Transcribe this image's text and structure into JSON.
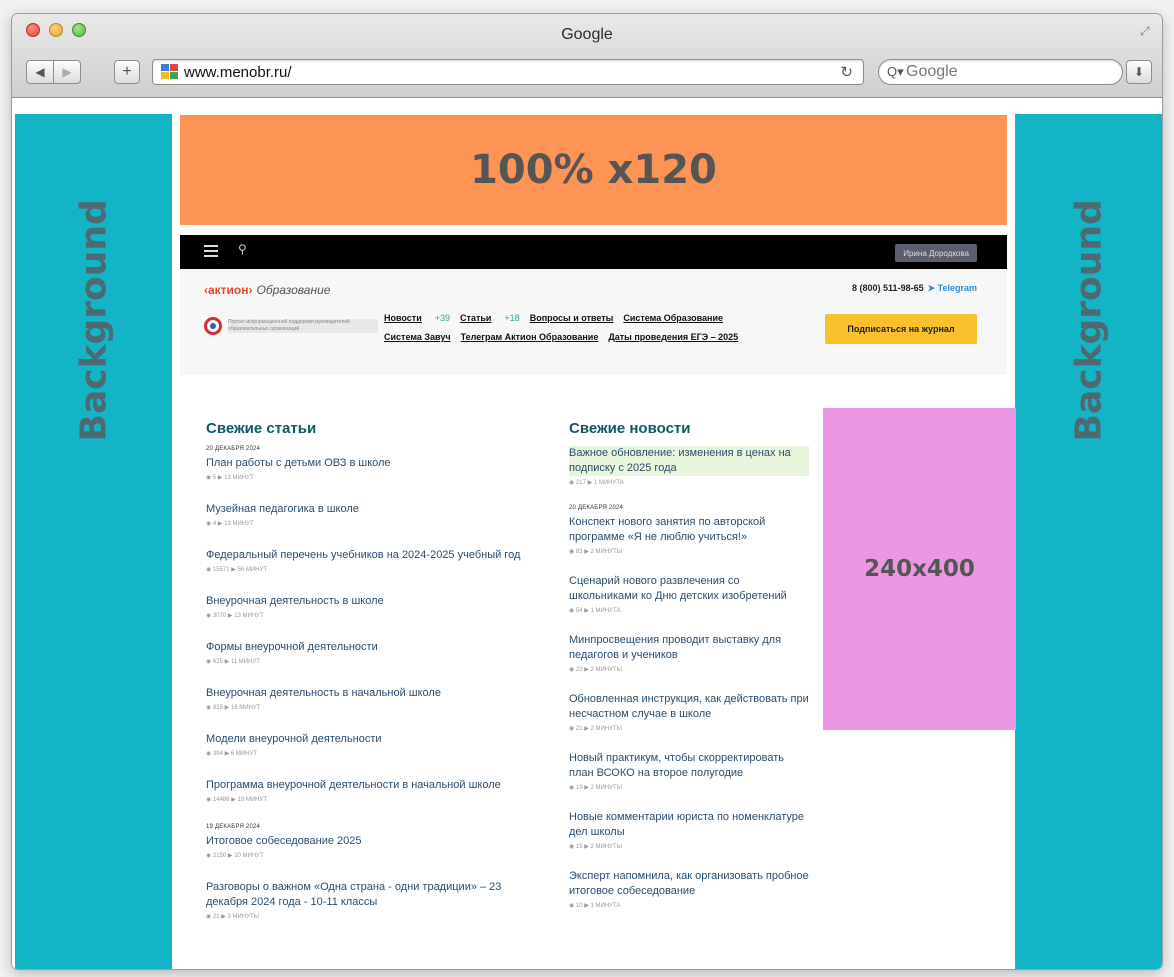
{
  "window": {
    "title": "Google",
    "url": "www.menobr.ru/",
    "search_placeholder": "Google"
  },
  "placeholders": {
    "background_left": "Background",
    "background_right": "Background",
    "top_banner": "100% x120",
    "side_banner": "240x400"
  },
  "site": {
    "user_label": "Ирина Дородкова",
    "logo_main": "‹актион›",
    "logo_sub": "Образование",
    "phone": "8 (800) 511-98-65",
    "telegram": "Telegram",
    "emblem_text": "Портал информационной поддержки руководителей образовательных организаций",
    "nav_row1": [
      {
        "label": "Новости",
        "count": "+39"
      },
      {
        "label": "Статьи",
        "count": "+18"
      },
      {
        "label": "Вопросы и ответы",
        "count": ""
      },
      {
        "label": "Система Образование",
        "count": ""
      }
    ],
    "nav_row2": [
      {
        "label": "Система Завуч"
      },
      {
        "label": "Телеграм Актион Образование"
      },
      {
        "label": "Даты проведения ЕГЭ – 2025"
      }
    ],
    "subscribe_label": "Подписаться на журнал"
  },
  "articles": {
    "title": "Свежие статьи",
    "items": [
      {
        "date": "20 ДЕКАБРЯ 2024",
        "title": "План работы с детьми ОВЗ в школе",
        "meta": "◉ 5   ▶ 13 МИНУТ"
      },
      {
        "date": "",
        "title": "Музейная педагогика в школе",
        "meta": "◉ 4   ▶ 13 МИНУТ"
      },
      {
        "date": "",
        "title": "Федеральный перечень учебников на 2024-2025 учебный год",
        "meta": "◉ 15571   ▶ 56 МИНУТ"
      },
      {
        "date": "",
        "title": "Внеурочная деятельность в школе",
        "meta": "◉ 3070   ▶ 13 МИНУТ"
      },
      {
        "date": "",
        "title": "Формы внеурочной деятельности",
        "meta": "◉ 625   ▶ 11 МИНУТ"
      },
      {
        "date": "",
        "title": "Внеурочная деятельность в начальной школе",
        "meta": "◉ 825   ▶ 16 МИНУТ"
      },
      {
        "date": "",
        "title": "Модели внеурочной деятельности",
        "meta": "◉ 394   ▶ 6 МИНУТ"
      },
      {
        "date": "",
        "title": "Программа внеурочной деятельности в начальной школе",
        "meta": "◉ 14486   ▶ 19 МИНУТ"
      },
      {
        "date": "19 ДЕКАБРЯ 2024",
        "title": "Итоговое собеседование 2025",
        "meta": "◉ 2150   ▶ 10 МИНУТ"
      },
      {
        "date": "",
        "title": "Разговоры о важном «Одна страна - одни традиции» – 23 декабря 2024 года - 10-11 классы",
        "meta": "◉ 21   ▶ 3 МИНУТЫ"
      }
    ]
  },
  "news": {
    "title": "Свежие новости",
    "items": [
      {
        "date": "",
        "title": "Важное обновление: изменения в ценах на подписку с 2025 года",
        "meta": "◉ 217   ▶ 1 МИНУТА",
        "highlight": true
      },
      {
        "date": "20 ДЕКАБРЯ 2024",
        "title": "Конспект нового занятия по авторской программе «Я не люблю учиться!»",
        "meta": "◉ 83   ▶ 2 МИНУТЫ"
      },
      {
        "date": "",
        "title": "Сценарий нового развлечения со школьниками ко Дню детских изобретений",
        "meta": "◉ 54   ▶ 1 МИНУТА"
      },
      {
        "date": "",
        "title": "Минпросвещения проводит выставку для педагогов и учеников",
        "meta": "◉ 23   ▶ 2 МИНУТЫ"
      },
      {
        "date": "",
        "title": "Обновленная инструкция, как действовать при несчастном случае в школе",
        "meta": "◉ 21   ▶ 2 МИНУТЫ"
      },
      {
        "date": "",
        "title": "Новый практикум, чтобы скорректировать план ВСОКО на второе полугодие",
        "meta": "◉ 19   ▶ 2 МИНУТЫ"
      },
      {
        "date": "",
        "title": "Новые комментарии юриста по номенклатуре дел школы",
        "meta": "◉ 15   ▶ 2 МИНУТЫ"
      },
      {
        "date": "",
        "title": "Эксперт напомнила, как организовать пробное итоговое собеседование",
        "meta": "◉ 10   ▶ 1 МИНУТА"
      }
    ]
  }
}
